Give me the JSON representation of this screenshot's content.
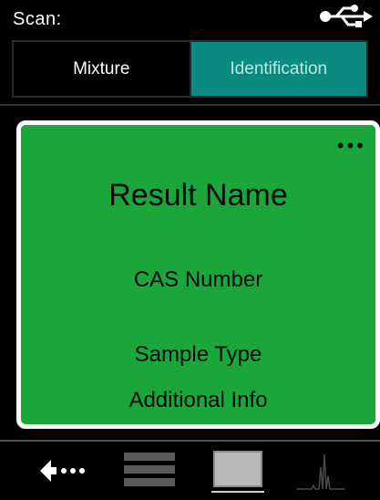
{
  "header": {
    "title": "Scan:",
    "status_icon": "usb-icon"
  },
  "tabs": [
    {
      "label": "Mixture",
      "active": false
    },
    {
      "label": "Identification",
      "active": true
    }
  ],
  "result_card": {
    "name": "Result Name",
    "cas": "CAS Number",
    "sample_type": "Sample Type",
    "additional_info": "Additional Info",
    "menu_icon": "more-dots-icon",
    "color": "#1aa63a"
  },
  "bottom_nav": [
    {
      "icon": "back-arrow-icon"
    },
    {
      "icon": "list-view-icon"
    },
    {
      "icon": "tile-view-icon",
      "active": true
    },
    {
      "icon": "spectrum-icon"
    }
  ],
  "colors": {
    "accent_tab": "#0b8a82",
    "card_green": "#1aa63a"
  }
}
